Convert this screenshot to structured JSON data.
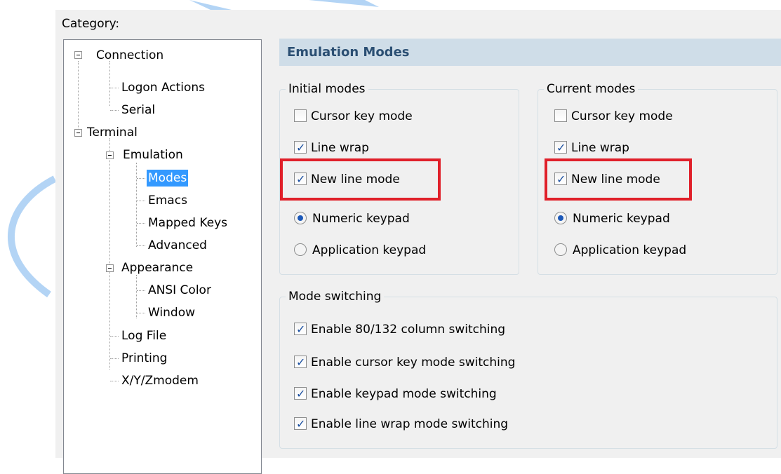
{
  "category_label": "Category:",
  "tree": {
    "items": [
      {
        "label": "Connection"
      },
      {
        "label": "Logon Actions"
      },
      {
        "label": "Serial"
      },
      {
        "label": "Terminal"
      },
      {
        "label": "Emulation"
      },
      {
        "label": "Modes"
      },
      {
        "label": "Emacs"
      },
      {
        "label": "Mapped Keys"
      },
      {
        "label": "Advanced"
      },
      {
        "label": "Appearance"
      },
      {
        "label": "ANSI Color"
      },
      {
        "label": "Window"
      },
      {
        "label": "Log File"
      },
      {
        "label": "Printing"
      },
      {
        "label": "X/Y/Zmodem"
      }
    ],
    "selected": "Modes"
  },
  "section_title": "Emulation Modes",
  "initial_modes": {
    "title": "Initial modes",
    "cursor_key_mode": "Cursor key mode",
    "line_wrap": "Line wrap",
    "new_line_mode": "New line mode",
    "numeric_keypad": "Numeric keypad",
    "application_keypad": "Application keypad"
  },
  "current_modes": {
    "title": "Current modes",
    "cursor_key_mode": "Cursor key mode",
    "line_wrap": "Line wrap",
    "new_line_mode": "New line mode",
    "numeric_keypad": "Numeric keypad",
    "application_keypad": "Application keypad"
  },
  "mode_switching": {
    "title": "Mode switching",
    "items": [
      {
        "label": "Enable 80/132 column switching"
      },
      {
        "label": "Enable cursor key mode switching"
      },
      {
        "label": "Enable keypad mode switching"
      },
      {
        "label": "Enable line wrap mode switching"
      }
    ]
  },
  "colors": {
    "header_bg": "#cfdde8",
    "header_text": "#2b4f73",
    "selection": "#3399ff",
    "highlight": "#e0202a",
    "decoration": "#b3d4f5"
  }
}
